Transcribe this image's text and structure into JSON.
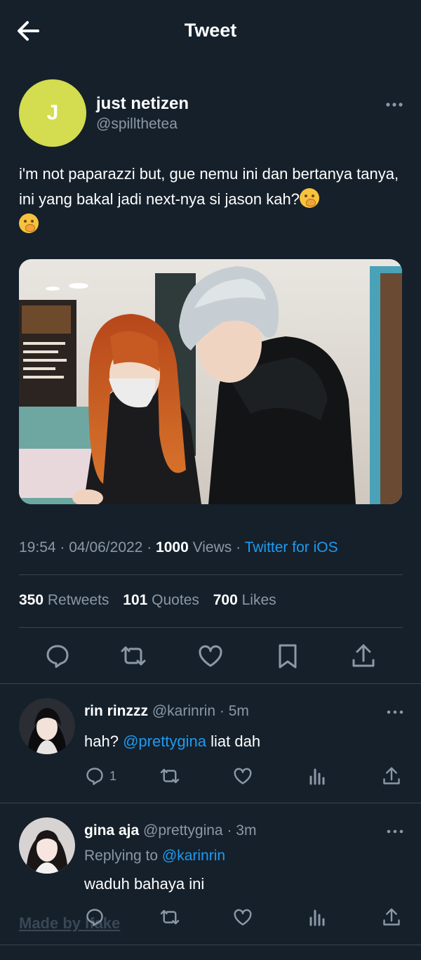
{
  "header": {
    "title": "Tweet",
    "back_icon": "arrow-left-icon"
  },
  "tweet": {
    "avatar_initial": "J",
    "avatar_color": "#d4dc4f",
    "name": "just netizen",
    "handle": "@spillthetea",
    "text": "i'm not paparazzi but, gue nemu ini dan bertanya tanya, ini yang bakal jadi next-nya si jason kah?",
    "emoji": [
      "hand-over-mouth-emoji",
      "hand-over-mouth-emoji"
    ],
    "time": "19:54",
    "date": "04/06/2022",
    "views_count": "1000",
    "views_label": "Views",
    "source": "Twitter for iOS",
    "separator": "·",
    "stats": {
      "retweets_count": "350",
      "retweets_label": "Retweets",
      "quotes_count": "101",
      "quotes_label": "Quotes",
      "likes_count": "700",
      "likes_label": "Likes"
    }
  },
  "replies": [
    {
      "name": "rin rinzzz",
      "handle": "@karinrin",
      "time": "5m",
      "text_before": "hah? ",
      "mention": "@prettygina",
      "text_after": " liat dah",
      "reply_count": "1"
    },
    {
      "name": "gina aja",
      "handle": "@prettygina",
      "time": "3m",
      "replying_to_label": "Replying to",
      "replying_to_handle": "@karinrin",
      "text": "waduh bahaya ini"
    }
  ],
  "watermark": "Made by Ifake",
  "colors": {
    "background": "#15202b",
    "accent": "#1d9bf0",
    "muted": "#8b98a5",
    "divider": "#38444d"
  }
}
